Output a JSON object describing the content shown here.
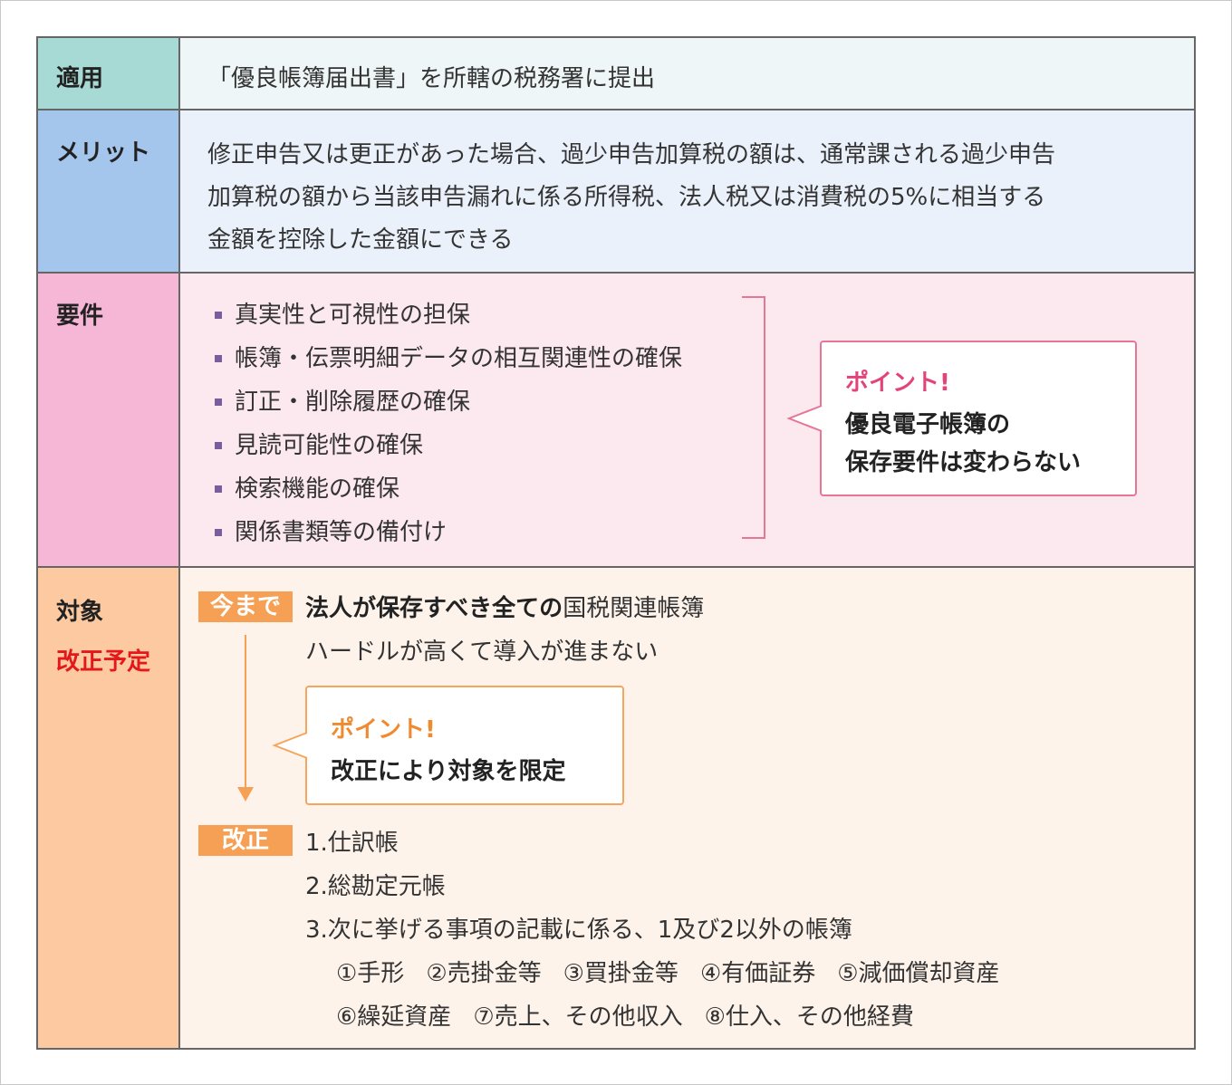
{
  "rows": {
    "apply": {
      "label": "適用",
      "text": "「優良帳簿届出書」を所轄の税務署に提出"
    },
    "merit": {
      "label": "メリット",
      "lines": [
        "修正申告又は更正があった場合、過少申告加算税の額は、通常課される過少申告",
        "加算税の額から当該申告漏れに係る所得税、法人税又は消費税の5%に相当する",
        "金額を控除した金額にできる"
      ]
    },
    "requirements": {
      "label": "要件",
      "items": [
        "真実性と可視性の担保",
        "帳簿・伝票明細データの相互関連性の確保",
        "訂正・削除履歴の確保",
        "見読可能性の確保",
        "検索機能の確保",
        "関係書類等の備付け"
      ],
      "point_title": "ポイント!",
      "point_lines": [
        "優良電子帳簿の",
        "保存要件は変わらない"
      ]
    },
    "target": {
      "label": "対象",
      "label_sub": "改正予定",
      "tag_before": "今まで",
      "before_bold": "法人が保存すべき全ての",
      "before_rest": "国税関連帳簿",
      "before_line2": "ハードルが高くて導入が進まない",
      "point_title": "ポイント!",
      "point_text": "改正により対象を限定",
      "tag_after": "改正",
      "after_items": [
        "1.仕訳帳",
        "2.総勘定元帳",
        "3.次に挙げる事項の記載に係る、1及び2以外の帳簿"
      ],
      "after_sub_1": [
        "①手形",
        "②売掛金等",
        "③買掛金等",
        "④有価証券",
        "⑤減価償却資産"
      ],
      "after_sub_2": [
        "⑥繰延資産",
        "⑦売上、その他収入",
        "⑧仕入、その他経費"
      ]
    }
  },
  "colors": {
    "border": "#666666",
    "pink_accent": "#e67696",
    "orange_accent": "#f5a055",
    "red_label": "#e4171b"
  }
}
